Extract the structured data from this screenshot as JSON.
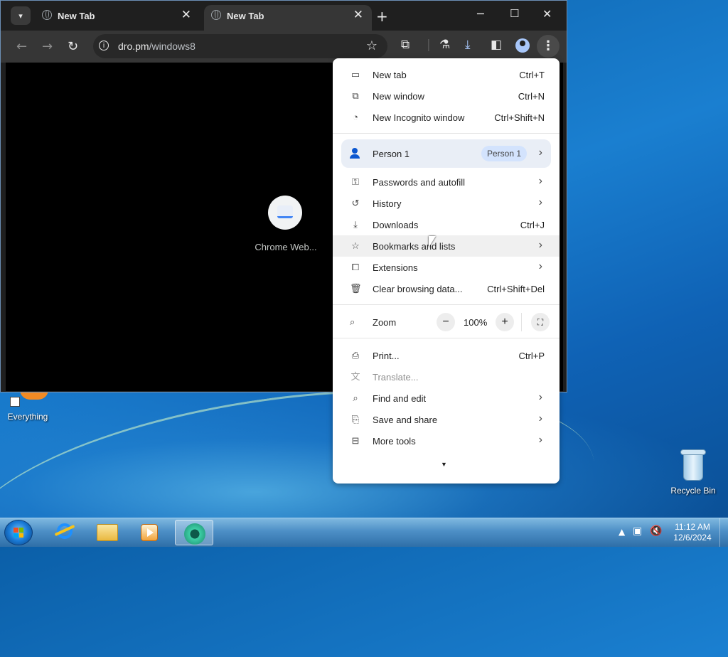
{
  "browser": {
    "tabs": [
      {
        "title": "New Tab"
      },
      {
        "title": "New Tab"
      }
    ],
    "url_domain": "dro.pm",
    "url_path": "/windows8",
    "shortcut": {
      "label": "Chrome Web..."
    }
  },
  "menu": {
    "group1": [
      {
        "label": "New tab",
        "shortcut": "Ctrl+T",
        "icon": "new-tab-icon"
      },
      {
        "label": "New window",
        "shortcut": "Ctrl+N",
        "icon": "new-window-icon"
      },
      {
        "label": "New Incognito window",
        "shortcut": "Ctrl+Shift+N",
        "icon": "incognito-icon"
      }
    ],
    "profile": {
      "label": "Person 1",
      "chip": "Person 1"
    },
    "group2": [
      {
        "label": "Passwords and autofill",
        "icon": "key-icon"
      },
      {
        "label": "History",
        "icon": "history-icon"
      },
      {
        "label": "Downloads",
        "shortcut": "Ctrl+J",
        "icon": "download-icon"
      },
      {
        "label": "Bookmarks and lists",
        "icon": "star-icon"
      },
      {
        "label": "Extensions",
        "icon": "extension-icon"
      },
      {
        "label": "Clear browsing data...",
        "shortcut": "Ctrl+Shift+Del",
        "icon": "trash-icon"
      }
    ],
    "zoom": {
      "label": "Zoom",
      "value": "100%"
    },
    "group3": [
      {
        "label": "Print...",
        "shortcut": "Ctrl+P",
        "icon": "print-icon"
      },
      {
        "label": "Translate...",
        "icon": "translate-icon"
      },
      {
        "label": "Find and edit",
        "icon": "find-icon"
      },
      {
        "label": "Save and share",
        "icon": "save-share-icon"
      },
      {
        "label": "More tools",
        "icon": "toolbox-icon"
      }
    ]
  },
  "desktop": {
    "everything_label": "Everything",
    "recycle_label": "Recycle Bin"
  },
  "taskbar": {
    "time": "11:12 AM",
    "date": "12/6/2024"
  }
}
